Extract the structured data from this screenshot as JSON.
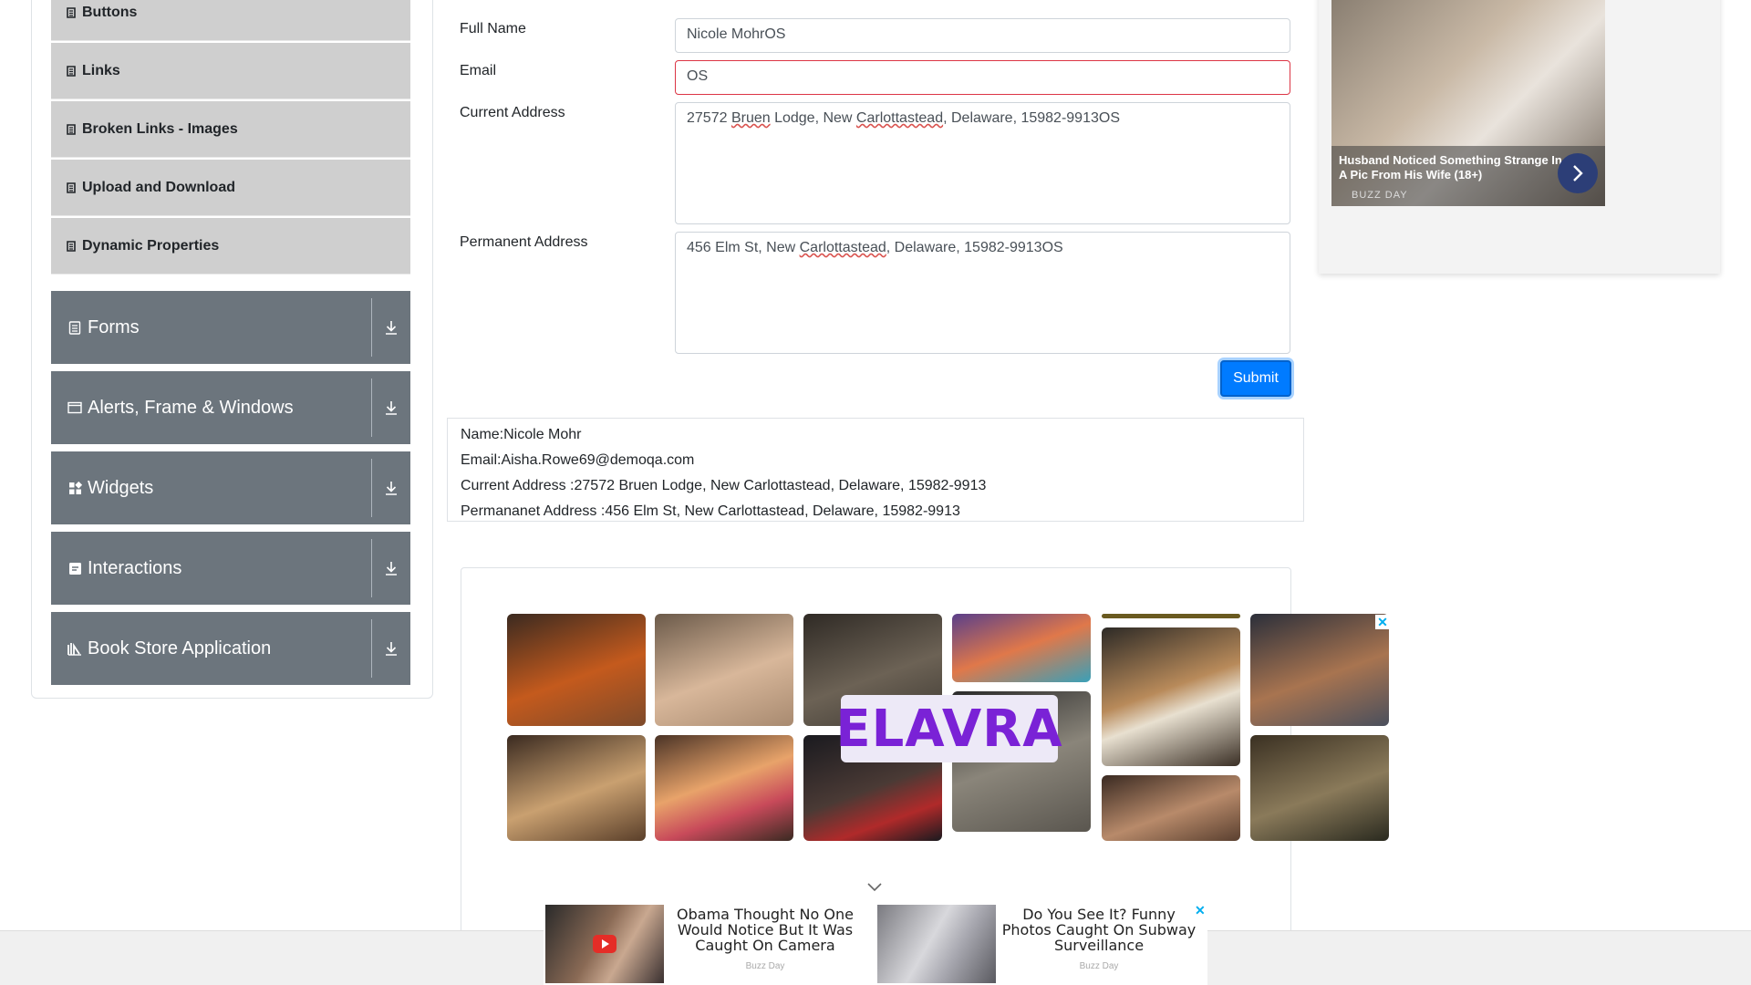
{
  "sidebar": {
    "elements_items": [
      {
        "label": "Buttons",
        "icon": "document-icon"
      },
      {
        "label": "Links",
        "icon": "document-icon"
      },
      {
        "label": "Broken Links - Images",
        "icon": "document-icon"
      },
      {
        "label": "Upload and Download",
        "icon": "document-icon"
      },
      {
        "label": "Dynamic Properties",
        "icon": "document-icon"
      }
    ],
    "groups": [
      {
        "label": "Forms",
        "icon": "clipboard-icon"
      },
      {
        "label": "Alerts, Frame & Windows",
        "icon": "window-icon"
      },
      {
        "label": "Widgets",
        "icon": "widgets-icon"
      },
      {
        "label": "Interactions",
        "icon": "interactions-icon"
      },
      {
        "label": "Book Store Application",
        "icon": "book-icon"
      }
    ]
  },
  "form": {
    "full_name_label": "Full Name",
    "full_name_value": "Nicole MohrOS",
    "email_label": "Email",
    "email_value": "OS",
    "current_address_label": "Current Address",
    "current_address_parts": [
      "27572 ",
      "Bruen",
      " Lodge, New ",
      "Carlottastead",
      ", Delaware, 15982-9913OS"
    ],
    "permanent_address_label": "Permanent Address",
    "permanent_address_parts": [
      "456 Elm St, New ",
      "Carlottastead",
      ", Delaware, 15982-9913OS"
    ],
    "submit_label": "Submit"
  },
  "output": {
    "name": "Name:Nicole Mohr",
    "email": "Email:Aisha.Rowe69@demoqa.com",
    "current_address": "Current Address :27572 Bruen Lodge, New Carlottastead, Delaware, 15982-9913",
    "permanent_address": "Permananet Address :456 Elm St, New Carlottastead, Delaware, 15982-9913"
  },
  "ad_right": {
    "headline": "Husband Noticed Something Strange In A Pic From His Wife (18+)",
    "source": "BUZZ DAY"
  },
  "ad_middle": {
    "brand": "ELAVRA",
    "close": "✕"
  },
  "banner": {
    "left_headline": "Obama Thought No One Would Notice But It Was Caught On Camera",
    "left_source": "Buzz Day",
    "right_headline": "Do You See It? Funny Photos Caught On Subway Surveillance",
    "right_source": "Buzz Day",
    "close": "✕"
  },
  "colors": {
    "sidebar_group_bg": "#6c757d",
    "sidebar_item_bg": "#cfcfcf",
    "submit_bg": "#007bff",
    "invalid_border": "#dc3545",
    "brand_purple": "#7a22d6"
  }
}
